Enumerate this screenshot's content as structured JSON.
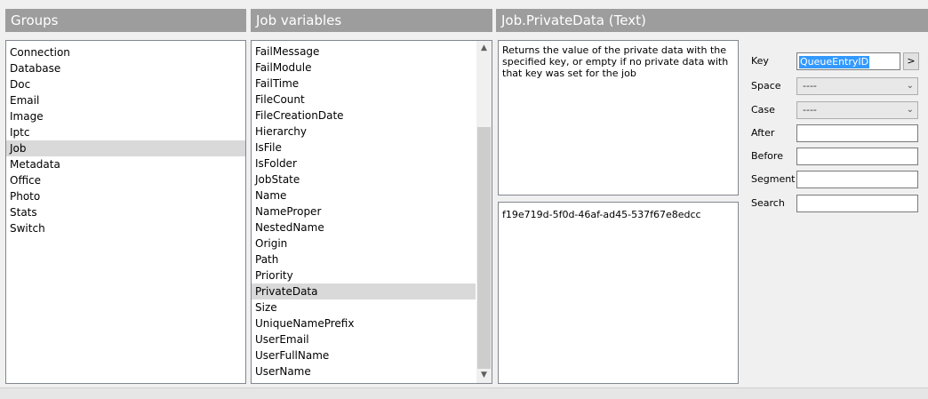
{
  "headers": {
    "groups": "Groups",
    "job_variables": "Job variables",
    "detail": "Job.PrivateData (Text)"
  },
  "groups": {
    "items": [
      "Connection",
      "Database",
      "Doc",
      "Email",
      "Image",
      "Iptc",
      "Job",
      "Metadata",
      "Office",
      "Photo",
      "Stats",
      "Switch"
    ],
    "selected": "Job"
  },
  "job_variables": {
    "items": [
      "FailMessage",
      "FailModule",
      "FailTime",
      "FileCount",
      "FileCreationDate",
      "Hierarchy",
      "IsFile",
      "IsFolder",
      "JobState",
      "Name",
      "NameProper",
      "NestedName",
      "Origin",
      "Path",
      "Priority",
      "PrivateData",
      "Size",
      "UniqueNamePrefix",
      "UserEmail",
      "UserFullName",
      "UserName"
    ],
    "selected": "PrivateData"
  },
  "description": "Returns the value of the private data with the specified key, or empty if no private data with that key was set for the job",
  "value": "f19e719d-5f0d-46af-ad45-537f67e8edcc",
  "fields": {
    "key_label": "Key",
    "key_value": "QueueEntryID",
    "key_button": ">",
    "space_label": "Space",
    "space_value": "----",
    "case_label": "Case",
    "case_value": "----",
    "after_label": "After",
    "before_label": "Before",
    "segment_label": "Segment",
    "search_label": "Search"
  },
  "icons": {
    "scroll_up": "chevron-up-icon",
    "scroll_down": "chevron-down-icon",
    "combo": "chevron-down-icon"
  },
  "colors": {
    "header_bg": "#9d9d9d",
    "selection": "#d9d9d9",
    "key_highlight": "#3399ff"
  }
}
